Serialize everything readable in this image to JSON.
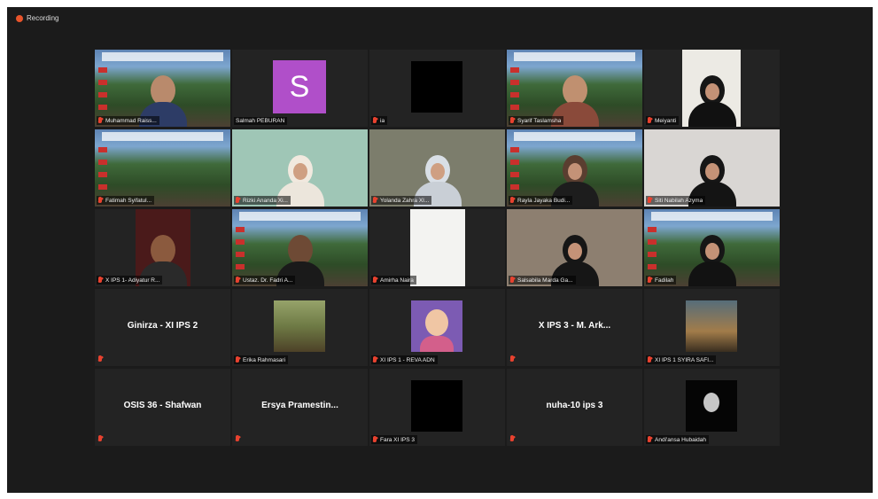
{
  "recording": {
    "label": "Recording",
    "indicator_color": "#e8542b"
  },
  "muted_color": "#e8422f",
  "tiles": [
    {
      "name": "Muhammad Raiss...",
      "video": "virtual-bg"
    },
    {
      "name": "Salmah PEBURAN",
      "avatar_letter": "S",
      "avatar_color": "#b04fc9"
    },
    {
      "name": "ia",
      "video": "black"
    },
    {
      "name": "Syarif Taslamsha",
      "video": "virtual-bg"
    },
    {
      "name": "Meiyanti",
      "video": "camera"
    },
    {
      "name": "Fatimah Syifatul...",
      "video": "virtual-bg"
    },
    {
      "name": "Rizki Ananda Xi...",
      "video": "camera"
    },
    {
      "name": "Yolanda Zahra XI...",
      "video": "camera"
    },
    {
      "name": "Rayla Jayaka Budi...",
      "video": "virtual-bg"
    },
    {
      "name": "Siti Nabilah Azyma",
      "video": "camera"
    },
    {
      "name": "X IPS 1- Adiyatur R...",
      "video": "camera"
    },
    {
      "name": "Ustaz. Dr. Fadri A...",
      "video": "virtual-bg"
    },
    {
      "name": "Amirha Naira",
      "video": "camera"
    },
    {
      "name": "Salsabila Marda Ga...",
      "video": "camera"
    },
    {
      "name": "Fadilah",
      "video": "virtual-bg"
    },
    {
      "center": "Ginirza - XI IPS 2",
      "video": "off"
    },
    {
      "name": "Erika Rahmasari",
      "video": "photo"
    },
    {
      "name": "XI IPS 1 - REVA ADN",
      "video": "photo"
    },
    {
      "center": "X IPS 3 - M. Ark...",
      "video": "off"
    },
    {
      "name": "XI IPS 1 SYIRA SAFI...",
      "video": "photo"
    },
    {
      "center": "OSIS 36 - Shafwan",
      "video": "off"
    },
    {
      "center": "Ersya Pramestin...",
      "video": "off"
    },
    {
      "name": "Fara XI IPS 3",
      "video": "black"
    },
    {
      "center": "nuha-10 ips 3",
      "video": "off"
    },
    {
      "name": "Andi'ansa Hubaidah",
      "video": "black"
    }
  ]
}
